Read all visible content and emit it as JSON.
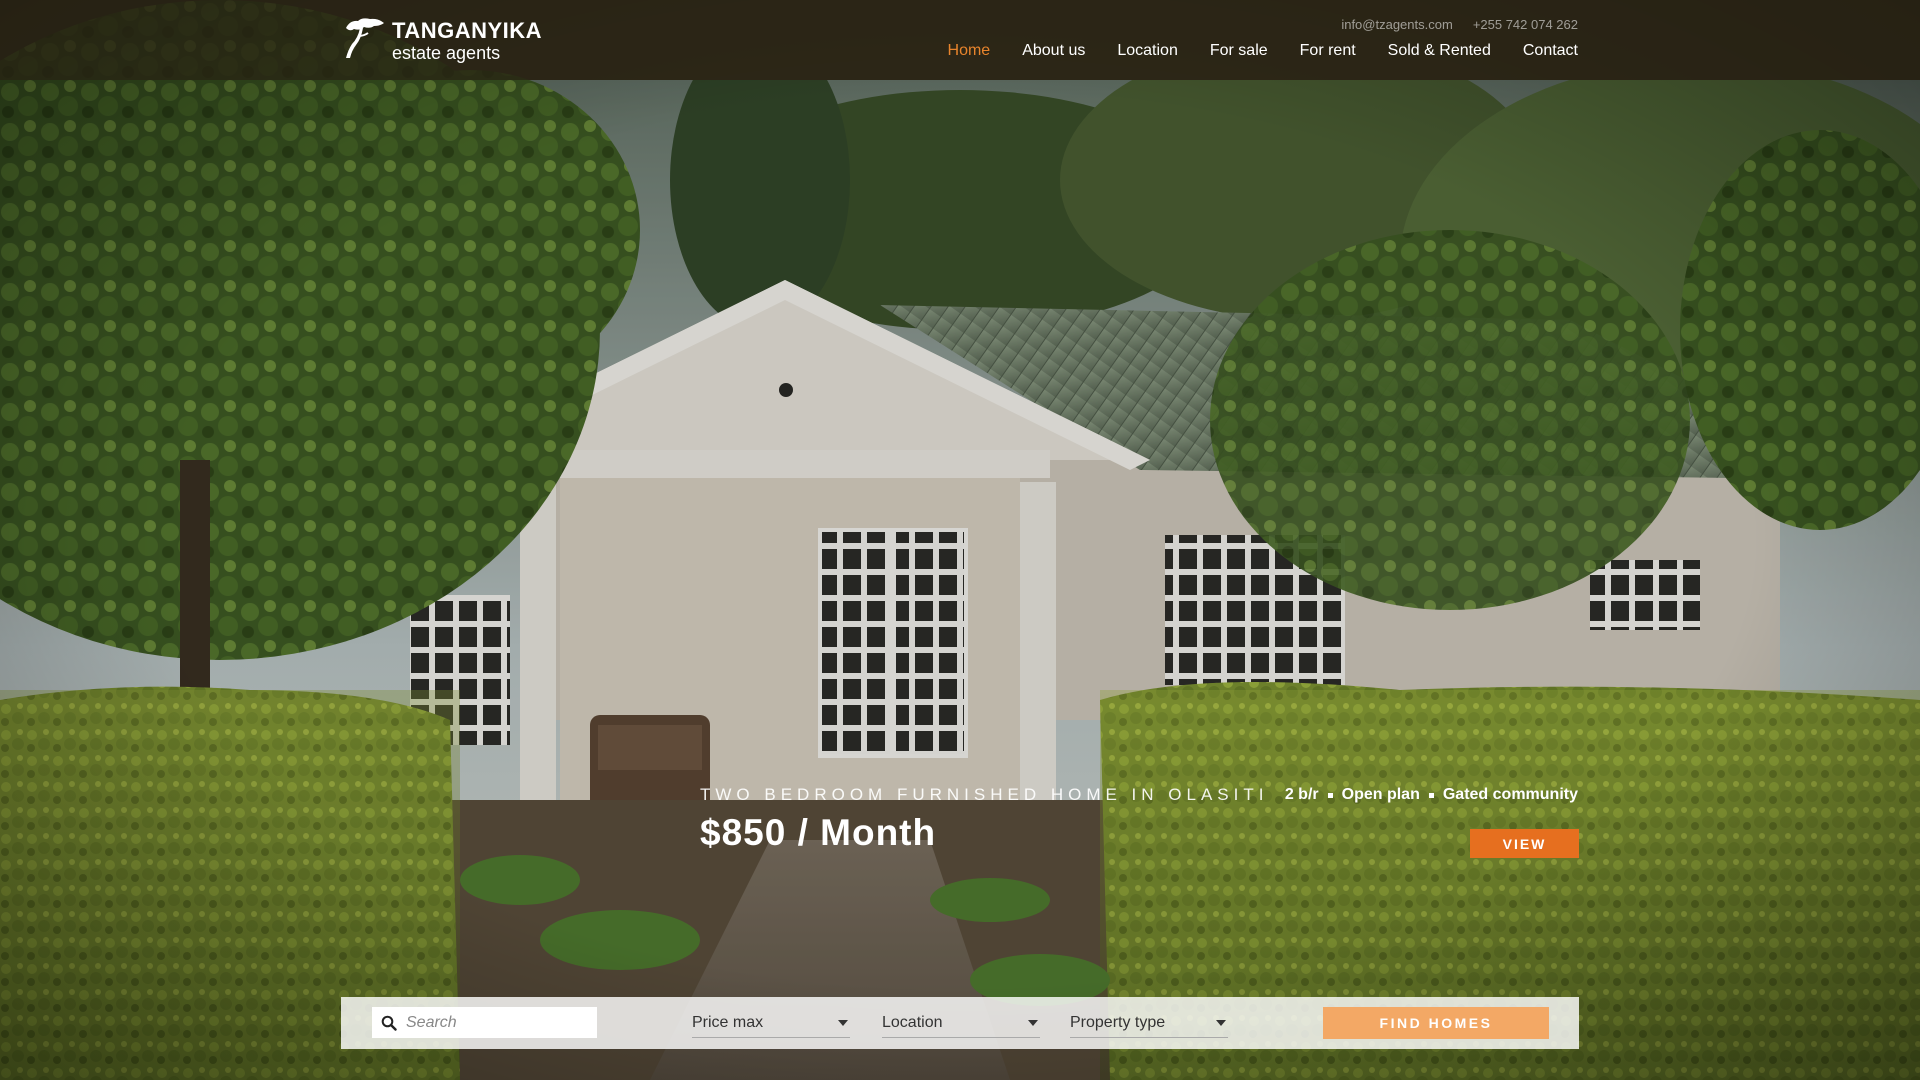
{
  "brand": {
    "name": "TANGANYIKA",
    "subtitle": "estate agents"
  },
  "contact": {
    "email": "info@tzagents.com",
    "phone": "+255 742 074 262"
  },
  "nav": {
    "items": [
      {
        "label": "Home",
        "active": true
      },
      {
        "label": "About us",
        "active": false
      },
      {
        "label": "Location",
        "active": false
      },
      {
        "label": "For sale",
        "active": false
      },
      {
        "label": "For rent",
        "active": false
      },
      {
        "label": "Sold & Rented",
        "active": false
      },
      {
        "label": "Contact",
        "active": false
      }
    ]
  },
  "featured": {
    "title": "TWO BEDROOM FURNISHED HOME IN OLASITI",
    "price": "$850 / Month",
    "tags": [
      "2 b/r",
      "Open plan",
      "Gated community"
    ],
    "view_label": "VIEW"
  },
  "search": {
    "placeholder": "Search",
    "price_max": "Price max",
    "location": "Location",
    "property_type": "Property type",
    "find_label": "FIND HOMES"
  },
  "colors": {
    "accent": "#e8842c",
    "view_button": "#e66f1f",
    "find_button": "#f3a865",
    "header_bg": "#28221499"
  },
  "icons": {
    "logo": "tree-icon",
    "search": "search-icon",
    "dropdown": "caret-down-icon"
  }
}
